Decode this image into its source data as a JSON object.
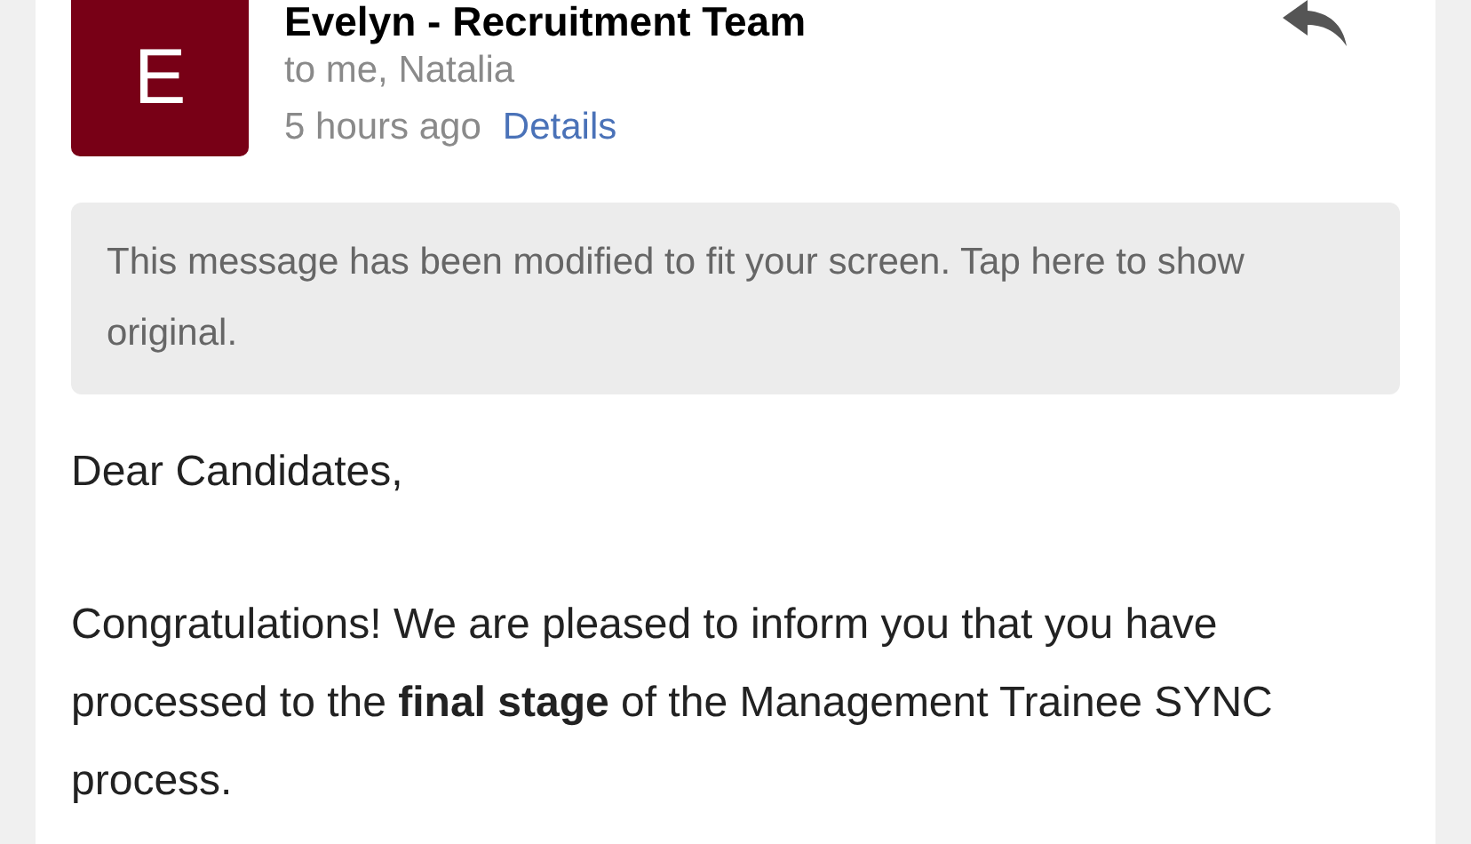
{
  "sender": {
    "initial": "E",
    "name": "Evelyn - Recruitment Team",
    "recipients": "to me, Natalia",
    "time": "5 hours ago",
    "details_link": "Details"
  },
  "notice": "This message has been modified to fit your screen. Tap here to show original.",
  "body": [
    "Dear Candidates,",
    "Congratulations! We are pleased to inform you that you have processed to the **final stage** of the Management Trainee SYNC process."
  ]
}
